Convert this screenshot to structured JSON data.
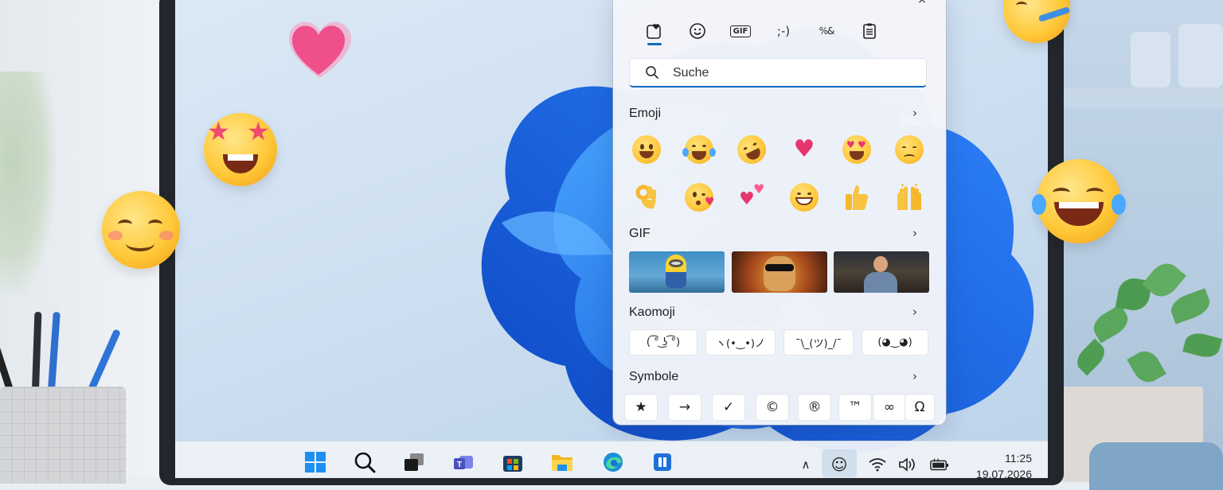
{
  "emoji_panel": {
    "tabs": [
      {
        "name": "emoji-heart-tab",
        "glyph": "♥"
      },
      {
        "name": "smiley-tab",
        "glyph": "☺"
      },
      {
        "name": "gif-tab",
        "glyph": "GIF"
      },
      {
        "name": "kaomoji-tab",
        "glyph": ";-)"
      },
      {
        "name": "symbols-tab",
        "glyph": "%&"
      },
      {
        "name": "clipboard-tab",
        "glyph": "▤"
      }
    ],
    "active_tab": "emoji-heart-tab",
    "search_text": "Suche",
    "sections": {
      "emoji": "Emoji",
      "gif": "GIF",
      "kaomoji": "Kaomoji",
      "symbols": "Symbole"
    },
    "chevron": "›",
    "kaomoji": [
      "( ͡° ͜ʖ ͡°)",
      "ヽ(•‿•)ノ",
      "¯\\_(ツ)_/¯",
      "(◕‿◕)"
    ],
    "symbols": [
      "★",
      "→",
      "✓",
      "©",
      "®",
      "™",
      "∞",
      "Ω"
    ],
    "close_glyph": "×"
  },
  "taskbar": {
    "icons": [
      "windows-start",
      "search",
      "task-view",
      "teams",
      "store",
      "file-explorer",
      "edge",
      "app"
    ],
    "tray": {
      "chevron": "∧",
      "emoji": "☺",
      "wifi": "wifi",
      "volume": "volume",
      "battery": "battery"
    },
    "time": "11:25",
    "date": "19.07.2026"
  },
  "colors": {
    "accent": "#0f6cbd",
    "bloom": "#1e6ff0",
    "heart": "#e8356e"
  }
}
